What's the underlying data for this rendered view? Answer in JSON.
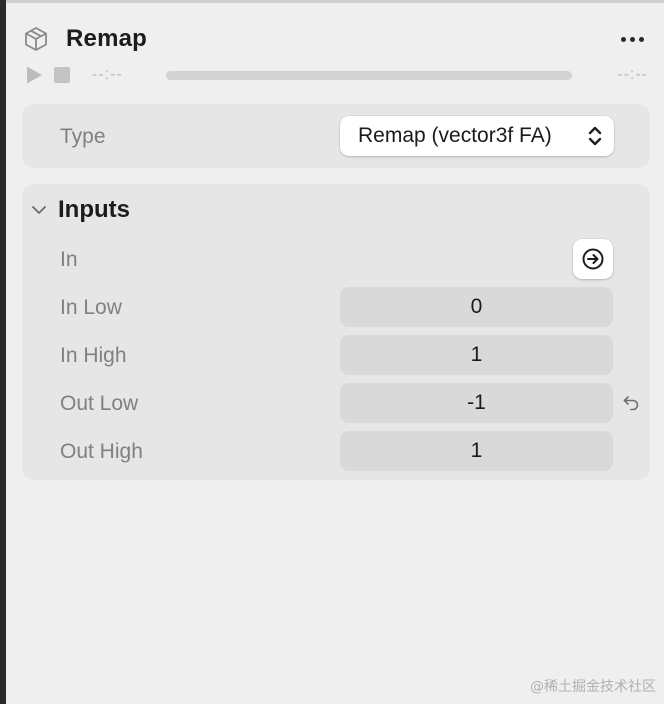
{
  "header": {
    "title": "Remap",
    "cube_icon": "cube-icon",
    "more_icon": "ellipsis-icon"
  },
  "playback": {
    "play_icon": "play-icon",
    "stop_icon": "stop-icon",
    "time_start": "--:--",
    "time_end": "--:--"
  },
  "type_row": {
    "label": "Type",
    "selected": "Remap (vector3f FA)",
    "icon": "chevron-updown-icon"
  },
  "inputs": {
    "title": "Inputs",
    "rows": [
      {
        "label": "In",
        "kind": "connect",
        "icon": "arrow-right-circle-icon"
      },
      {
        "label": "In Low",
        "value": "0"
      },
      {
        "label": "In High",
        "value": "1"
      },
      {
        "label": "Out Low",
        "value": "-1",
        "reset_icon": "undo-icon"
      },
      {
        "label": "Out High",
        "value": "1"
      }
    ]
  },
  "watermark": "@稀土掘金技术社区",
  "colors": {
    "panel_bg": "#efefef",
    "card_bg": "#e6e6e6",
    "field_bg": "#d9d9d9",
    "label": "#808080",
    "text": "#1b1b1b"
  }
}
